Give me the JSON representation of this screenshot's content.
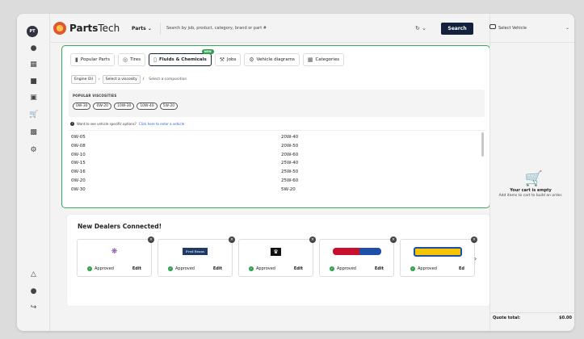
{
  "app": {
    "logo_main": "Parts",
    "logo_sub": "Tech",
    "avatar": "PT"
  },
  "header": {
    "parts_label": "Parts",
    "search_placeholder": "Search by job, product, category, brand or part #",
    "search_button": "Search"
  },
  "tabs": [
    {
      "label": "Popular Parts",
      "icon": "spark-plug-icon"
    },
    {
      "label": "Tires",
      "icon": "tire-icon"
    },
    {
      "label": "Fluids & Chemicals",
      "icon": "fluid-icon",
      "badge": "NEW",
      "active": true
    },
    {
      "label": "Jobs",
      "icon": "wrench-icon"
    },
    {
      "label": "Vehicle diagrams",
      "icon": "diagram-icon"
    },
    {
      "label": "Categories",
      "icon": "grid-icon"
    }
  ],
  "breadcrumb": {
    "item1": "Engine Oil",
    "item2": "Select a viscosity",
    "item3": "Select a composition"
  },
  "popular": {
    "heading": "POPULAR VISCOSITIES",
    "chips": [
      "0W-30",
      "0W-20",
      "10W-30",
      "10W-40",
      "5W-20"
    ]
  },
  "vehicle_note": {
    "text": "Want to see vehicle specific options?",
    "link": "Click here to enter a vehicle"
  },
  "viscosities": {
    "col1": [
      "0W-05",
      "0W-08",
      "0W-10",
      "0W-15",
      "0W-16",
      "0W-20",
      "0W-30"
    ],
    "col2": [
      "20W-40",
      "20W-50",
      "20W-60",
      "25W-40",
      "25W-50",
      "25W-60",
      "5W-20"
    ]
  },
  "dealers": {
    "title": "New Dealers Connected!",
    "cards": [
      {
        "status": "Approved",
        "edit": "Edit"
      },
      {
        "status": "Approved",
        "edit": "Edit",
        "logo_text": "Fred Beans"
      },
      {
        "status": "Approved",
        "edit": "Edit"
      },
      {
        "status": "Approved",
        "edit": "Edit"
      },
      {
        "status": "Approved",
        "edit": "Ed"
      }
    ]
  },
  "right": {
    "select_vehicle": "Select Vehicle",
    "cart_empty": "Your cart is empty",
    "cart_hint": "Add items to cart to build an order.",
    "quote_label": "Quote total:",
    "quote_value": "$0.00"
  },
  "colors": {
    "accent": "#14213d",
    "active_border": "#3aa85a",
    "approved": "#2e9e4f"
  }
}
